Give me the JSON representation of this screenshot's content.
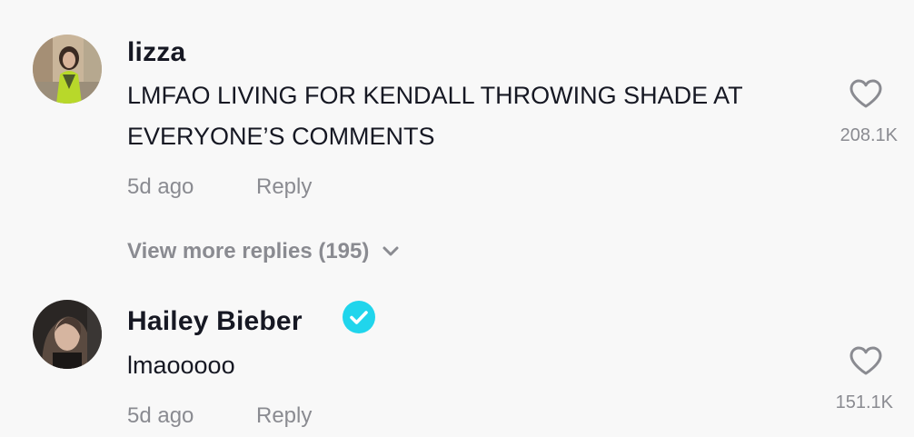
{
  "comments": [
    {
      "username": "lizza",
      "text": "LMFAO LIVING FOR KENDALL THROWING SHADE AT EVERYONE’S COMMENTS",
      "time": "5d ago",
      "reply_label": "Reply",
      "likes": "208.1K",
      "view_more_replies": "View more replies (195)"
    },
    {
      "username": "Hailey Bieber",
      "verified": true,
      "text": "lmaooooo",
      "time": "5d ago",
      "reply_label": "Reply",
      "likes": "151.1K"
    }
  ],
  "colors": {
    "background": "#f8f8f8",
    "primary_text": "#161823",
    "secondary_text": "#8a8b91",
    "verified_badge": "#20d5ec"
  },
  "icons": {
    "like": "heart-outline-icon",
    "verified": "verified-check-icon",
    "expand": "chevron-down-icon"
  }
}
